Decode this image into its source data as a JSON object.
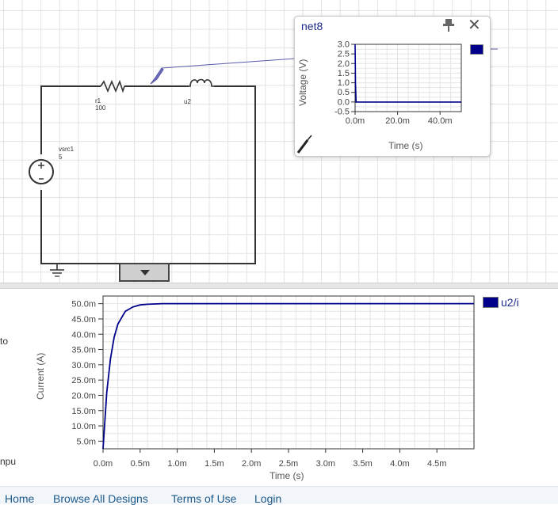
{
  "schematic": {
    "resistor": {
      "name": "r1",
      "value": "100"
    },
    "inductor": {
      "name": "u2"
    },
    "source": {
      "name": "vsrc1",
      "value": "5"
    }
  },
  "probe": {
    "title": "net8",
    "ylabel": "Voltage (V)",
    "xlabel": "Time (s)",
    "y_ticks": [
      "3.0",
      "2.5",
      "2.0",
      "1.5",
      "1.0",
      "0.5",
      "0.0",
      "-0.5"
    ],
    "x_ticks": [
      "0.0m",
      "20.0m",
      "40.0m"
    ],
    "icons": {
      "pin": "pin-icon",
      "close": "close-icon",
      "probe": "probe-tool-icon"
    }
  },
  "main_plot": {
    "ylabel": "Current (A)",
    "xlabel": "Time (s)",
    "legend": "u2/i",
    "y_ticks": [
      "50.0m",
      "45.0m",
      "40.0m",
      "35.0m",
      "30.0m",
      "25.0m",
      "20.0m",
      "15.0m",
      "10.0m",
      "5.0m"
    ],
    "x_ticks": [
      "0.0m",
      "0.5m",
      "1.0m",
      "1.5m",
      "2.0m",
      "2.5m",
      "3.0m",
      "3.5m",
      "4.0m",
      "4.5m"
    ]
  },
  "side": {
    "cut1": "to",
    "cut2": "npu"
  },
  "footer": {
    "links": [
      "Home",
      "Browse All Designs",
      "Terms of Use",
      "Login"
    ]
  },
  "chart_data": [
    {
      "type": "line",
      "title": "net8",
      "xlabel": "Time (s)",
      "ylabel": "Voltage (V)",
      "xlim": [
        0,
        0.05
      ],
      "ylim": [
        -0.5,
        3.0
      ],
      "series": [
        {
          "x": [
            0,
            0.0002,
            0.0005,
            0.05
          ],
          "values": [
            3.0,
            1.0,
            0.0,
            0.0
          ]
        }
      ],
      "color": "#00008b",
      "grid": true
    },
    {
      "type": "line",
      "xlabel": "Time (s)",
      "ylabel": "Current (A)",
      "xlim": [
        0,
        0.005
      ],
      "ylim": [
        0.0025,
        0.0525
      ],
      "series": [
        {
          "name": "u2/i",
          "x": [
            0,
            5e-05,
            0.0001,
            0.00015,
            0.0002,
            0.0003,
            0.0004,
            0.0005,
            0.0006,
            0.0008,
            0.001,
            0.002,
            0.003,
            0.004,
            0.005
          ],
          "values": [
            0.0025,
            0.021,
            0.032,
            0.039,
            0.0433,
            0.0475,
            0.0489,
            0.0496,
            0.0498,
            0.05,
            0.05,
            0.05,
            0.05,
            0.05,
            0.05
          ]
        }
      ],
      "color": "#00008b",
      "legend": "top-right",
      "grid": true
    }
  ]
}
